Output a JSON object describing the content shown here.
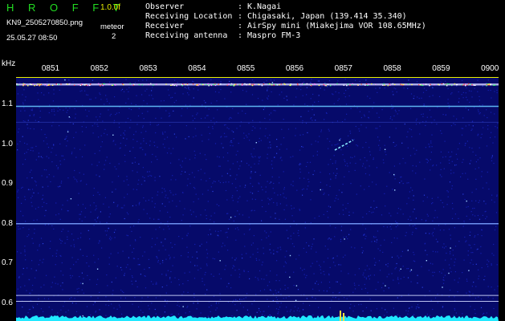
{
  "header": {
    "logo": "H R O F F T",
    "version": "1.0.0f",
    "filename": "KN9_2505270850.png",
    "datetime": "25.05.27 08:50",
    "mode_label": "meteor",
    "mode_value": "2",
    "fields": [
      {
        "label": "Observer",
        "sep": ":",
        "value": "K.Nagai"
      },
      {
        "label": "Receiving Location",
        "sep": ":",
        "value": "Chigasaki, Japan (139.414 35.340)"
      },
      {
        "label": "Receiver",
        "sep": ":",
        "value": "AirSpy mini (Miakejima VOR 108.65MHz)"
      },
      {
        "label": "Receiving antenna",
        "sep": ":",
        "value": "Maspro FM-3"
      }
    ]
  },
  "colors": {
    "logo": "#22dd22",
    "version": "#e8f000",
    "axis": "#e8f000",
    "background_noise": "#0a0f8a",
    "carrier": "#66c8ff",
    "meteor": "#88e8ff"
  },
  "chart_data": {
    "type": "heatmap",
    "ylabel": "kHz",
    "y_ticks": [
      "1.1",
      "1.0",
      "0.9",
      "0.8",
      "0.7",
      "0.6"
    ],
    "y_tick_values": [
      1.1,
      1.0,
      0.9,
      0.8,
      0.7,
      0.6
    ],
    "ylim": [
      0.58,
      1.16
    ],
    "x_ticks": [
      "0851",
      "0852",
      "0853",
      "0854",
      "0855",
      "0856",
      "0857",
      "0858",
      "0859",
      "0900"
    ],
    "horizontal_lines_khz": [
      1.15,
      1.095,
      1.055,
      0.8,
      0.62,
      0.605
    ],
    "meteor_echo": {
      "time_start": "0856",
      "time_end": "0857",
      "khz_start": 0.985,
      "khz_end": 1.01
    }
  }
}
